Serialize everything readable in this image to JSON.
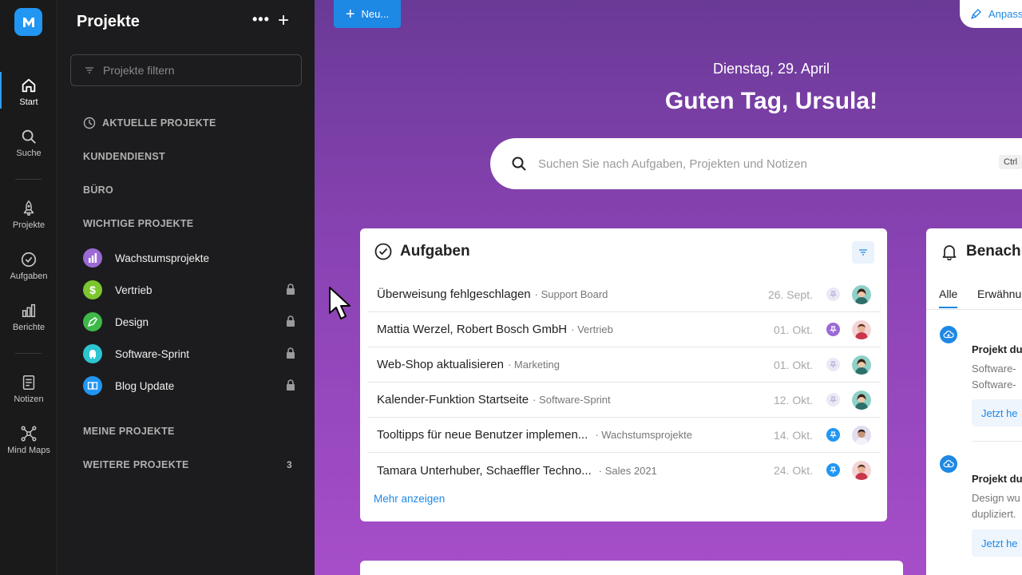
{
  "rail": {
    "items": [
      {
        "label": "Start",
        "icon": "home-icon"
      },
      {
        "label": "Suche",
        "icon": "search-icon"
      },
      {
        "label": "Projekte",
        "icon": "rocket-icon"
      },
      {
        "label": "Aufgaben",
        "icon": "check-circle-icon"
      },
      {
        "label": "Berichte",
        "icon": "bar-chart-icon"
      },
      {
        "label": "Notizen",
        "icon": "note-icon"
      },
      {
        "label": "Mind Maps",
        "icon": "mindmap-icon"
      }
    ]
  },
  "panel": {
    "title": "Projekte",
    "more": "•••",
    "add": "+",
    "filter_placeholder": "Projekte filtern",
    "sections": {
      "recent": "AKTUELLE PROJEKTE",
      "customer": "KUNDENDIENST",
      "office": "BÜRO",
      "important": "WICHTIGE PROJEKTE",
      "mine": "MEINE PROJEKTE",
      "more": "WEITERE PROJEKTE",
      "more_count": "3"
    },
    "projects": [
      {
        "name": "Wachstumsprojekte",
        "color": "#9c6ad6",
        "locked": false
      },
      {
        "name": "Vertrieb",
        "color": "#7cc62e",
        "locked": true
      },
      {
        "name": "Design",
        "color": "#3fb84a",
        "locked": true
      },
      {
        "name": "Software-Sprint",
        "color": "#2cc5d2",
        "locked": true
      },
      {
        "name": "Blog Update",
        "color": "#2196f3",
        "locked": true
      }
    ]
  },
  "main": {
    "new_button": "Neu...",
    "adjust_button": "Anpass",
    "date": "Dienstag, 29. April",
    "greeting": "Guten Tag, Ursula!",
    "search_placeholder": "Suchen Sie nach Aufgaben, Projekten und Notizen",
    "search_shortcut": "Ctrl"
  },
  "tasks": {
    "title": "Aufgaben",
    "items": [
      {
        "title": "Überweisung fehlgeschlagen",
        "project": "· Support Board",
        "date": "26. Sept.",
        "pin": "#e6e3f4"
      },
      {
        "title": "Mattia Werzel, Robert Bosch GmbH",
        "project": "· Vertrieb",
        "date": "01. Okt.",
        "pin": "#9c6ad6"
      },
      {
        "title": "Web-Shop aktualisieren",
        "project": "· Marketing",
        "date": "01. Okt.",
        "pin": "#e6e3f4"
      },
      {
        "title": "Kalender-Funktion Startseite",
        "project": "· Software-Sprint",
        "date": "12. Okt.",
        "pin": "#e6e3f4"
      },
      {
        "title": "Tooltipps für neue Benutzer implemen...",
        "project": "· Wachstumsprojekte",
        "date": "14. Okt.",
        "pin": "#2196f3"
      },
      {
        "title": "Tamara Unterhuber, Schaeffler Techno...",
        "project": "· Sales 2021",
        "date": "24. Okt.",
        "pin": "#2196f3"
      }
    ],
    "more_link": "Mehr anzeigen"
  },
  "notifications": {
    "title": "Benachr",
    "tabs": [
      "Alle",
      "Erwähnu"
    ],
    "items": [
      {
        "title": "Projekt du",
        "lines": [
          "Software-",
          "Software-"
        ],
        "button": "Jetzt he"
      },
      {
        "title": "Projekt du",
        "lines": [
          "Design wu",
          "dupliziert."
        ],
        "button": "Jetzt he"
      }
    ]
  }
}
